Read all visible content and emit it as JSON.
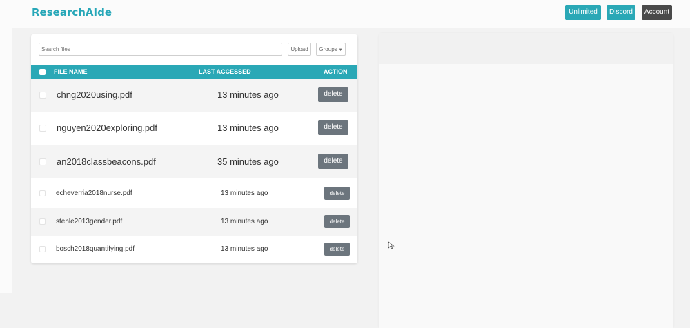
{
  "header": {
    "brand": "ResearchAIde",
    "buttons": {
      "unlimited": "Unlimited",
      "discord": "Discord",
      "account": "Account"
    }
  },
  "files_panel": {
    "search_placeholder": "Search files",
    "upload_label": "Upload",
    "groups_label": "Groups",
    "columns": {
      "file_name": "FILE NAME",
      "last_accessed": "LAST ACCESSED",
      "action": "ACTION"
    },
    "rows": [
      {
        "file_name": "chng2020using.pdf",
        "last_accessed": "13 minutes ago",
        "action": "delete"
      },
      {
        "file_name": "nguyen2020exploring.pdf",
        "last_accessed": "13 minutes ago",
        "action": "delete"
      },
      {
        "file_name": "an2018classbeacons.pdf",
        "last_accessed": "35 minutes ago",
        "action": "delete"
      },
      {
        "file_name": "echeverria2018nurse.pdf",
        "last_accessed": "13 minutes ago",
        "action": "delete"
      },
      {
        "file_name": "stehle2013gender.pdf",
        "last_accessed": "13 minutes ago",
        "action": "delete"
      },
      {
        "file_name": "bosch2018quantifying.pdf",
        "last_accessed": "13 minutes ago",
        "action": "delete"
      }
    ]
  },
  "colors": {
    "accent": "#2aa8b6",
    "account_button": "#4a4a4a",
    "delete_button": "#6c757d"
  },
  "icons": {
    "groups_caret": "chevron-down-icon",
    "pointer": "mouse-cursor-icon"
  }
}
